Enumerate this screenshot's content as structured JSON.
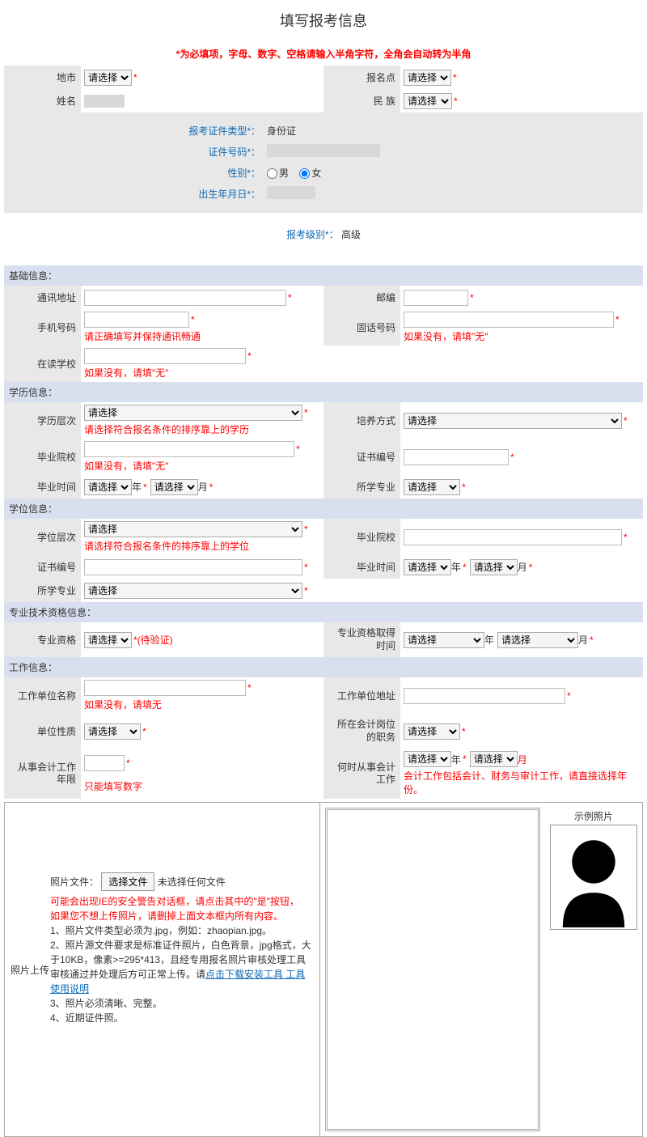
{
  "title": "填写报考信息",
  "warning": "*为必填项，字母、数字、空格请输入半角字符，全角会自动转为半角",
  "opt_select": "请选择",
  "top": {
    "city": "地市",
    "reg_point": "报名点",
    "name": "姓名",
    "ethnic": "民 族"
  },
  "center": {
    "id_type": "报考证件类型*",
    "id_type_val": "身份证",
    "id_no": "证件号码*",
    "gender": "性别*",
    "male": "男",
    "female": "女",
    "dob": "出生年月日*"
  },
  "level": {
    "label": "报考级别*",
    "value": "高级"
  },
  "sections": {
    "basic": "基础信息：",
    "edu": "学历信息：",
    "degree": "学位信息：",
    "pro": "专业技术资格信息：",
    "work": "工作信息："
  },
  "basic": {
    "addr": "通讯地址",
    "zip": "邮编",
    "mobile": "手机号码",
    "mobile_hint": "请正确填写并保持通讯畅通",
    "tel": "固话号码",
    "tel_hint": "如果没有，请填\"无\"",
    "school": "在读学校",
    "school_hint": "如果没有，请填\"无\""
  },
  "edu": {
    "level": "学历层次",
    "level_hint": "请选择符合报名条件的排序靠上的学历",
    "mode": "培养方式",
    "grad_school": "毕业院校",
    "grad_school_hint": "如果没有，请填\"无\"",
    "cert_no": "证书编号",
    "grad_time": "毕业时间",
    "year": "年",
    "month": "月",
    "major": "所学专业"
  },
  "degree": {
    "level": "学位层次",
    "level_hint": "请选择符合报名条件的排序靠上的学位",
    "school": "毕业院校",
    "cert_no": "证书编号",
    "grad_time": "毕业时间",
    "year": "年",
    "month": "月",
    "major": "所学专业"
  },
  "pro": {
    "qual": "专业资格",
    "pending": "*(待验证)",
    "time": "专业资格取得时间",
    "year": "年",
    "month": "月"
  },
  "work": {
    "unit": "工作单位名称",
    "unit_hint": "如果没有，请填无",
    "unit_addr": "工作单位地址",
    "nature": "单位性质",
    "position": "所在会计岗位的职务",
    "years": "从事会计工作年限",
    "years_hint": "只能填写数字",
    "start": "何时从事会计工作",
    "year": "年",
    "month": "月",
    "start_hint": "会计工作包括会计、财务与审计工作，请直接选择年份。"
  },
  "photo": {
    "upload_label": "照片上传",
    "file_label": "照片文件：",
    "choose_file": "选择文件",
    "no_file": "未选择任何文件",
    "warn1": "可能会出现IE的安全警告对话框，请点击其中的\"是\"按钮，",
    "warn2": "如果您不想上传照片，请删掉上面文本框内所有内容。",
    "req1": "1、照片文件类型必须为.jpg，例如：zhaopian.jpg。",
    "req2": "2、照片源文件要求是标准证件照片，白色背景，jpg格式，大于10KB，像素>=295*413，且经专用报名照片审核处理工具审核通过并处理后方可正常上传。请",
    "link": "点击下载安装工具 工具使用说明",
    "req3": "3、照片必须清晰、完整。",
    "req4": "4、近期证件照。",
    "sample": "示例照片"
  }
}
